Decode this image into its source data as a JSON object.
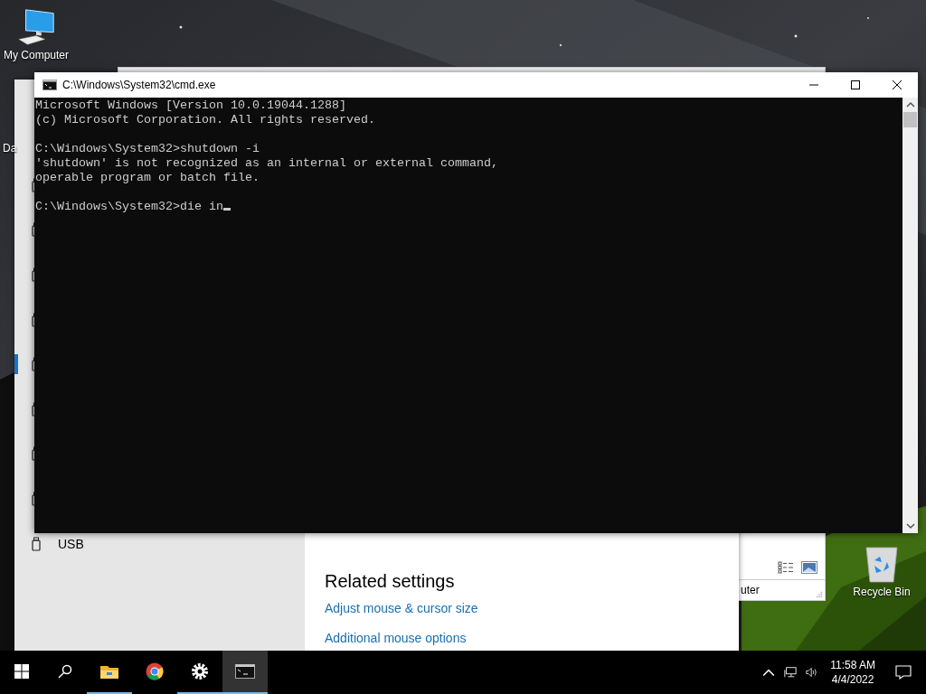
{
  "desktop_icons": [
    {
      "kind": "computer",
      "label": "My Computer"
    },
    {
      "kind": "hidden",
      "label": "Da"
    },
    {
      "kind": "recycle",
      "label": "Recycle Bin"
    }
  ],
  "settings_window": {
    "nav_items": [
      {
        "selected": false
      },
      {
        "selected": false
      },
      {
        "selected": false
      },
      {
        "selected": false
      },
      {
        "selected": true
      },
      {
        "selected": false
      },
      {
        "selected": false
      },
      {
        "selected": false
      },
      {
        "label": "USB",
        "selected": false
      }
    ],
    "related_settings": {
      "heading": "Related settings",
      "links": [
        "Adjust mouse & cursor size",
        "Additional mouse options"
      ]
    }
  },
  "explorer_window": {
    "status_text": "uter"
  },
  "console_window": {
    "title": "C:\\Windows\\System32\\cmd.exe",
    "blocks": [
      [
        "Microsoft Windows [Version 10.0.19044.1288]",
        "(c) Microsoft Corporation. All rights reserved."
      ],
      [
        "C:\\Windows\\System32>shutdown -i",
        "'shutdown' is not recognized as an internal or external command,",
        "operable program or batch file."
      ],
      [
        "C:\\Windows\\System32>die in"
      ]
    ]
  },
  "taskbar": {
    "apps": [
      {
        "kind": "explorer",
        "running": true,
        "selected": false
      },
      {
        "kind": "chrome",
        "running": false,
        "selected": false
      },
      {
        "kind": "settings",
        "running": true,
        "selected": false
      },
      {
        "kind": "console",
        "running": true,
        "selected": true
      }
    ],
    "time": "11:58 AM",
    "date": "4/4/2022"
  }
}
